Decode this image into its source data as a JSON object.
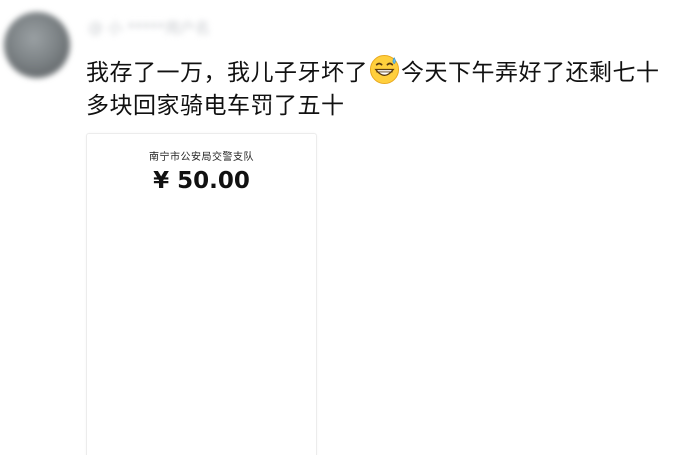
{
  "post": {
    "username": "@ 小 *****用户名",
    "text_part1": "我存了一万，我儿子牙坏了",
    "emoji": "grinning-sweat-icon",
    "text_part2": "今天下午弄好了还剩七十多块回家骑电车罚了五十"
  },
  "receipt": {
    "organization": "南宁市公安局交警支队",
    "amount": "¥ 50.00"
  }
}
